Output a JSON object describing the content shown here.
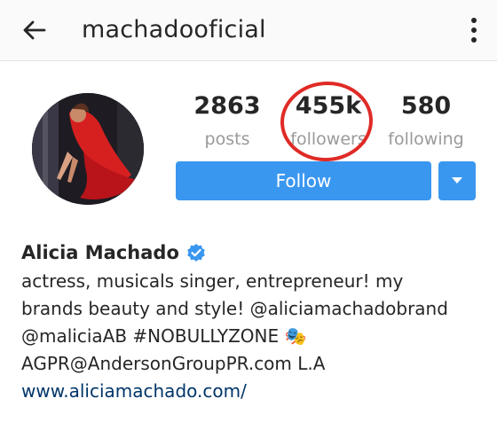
{
  "header": {
    "username": "machadooficial",
    "back_icon": "arrow-back-icon",
    "menu_icon": "more-vertical-icon"
  },
  "profile": {
    "avatar_alt": "profile photo",
    "stats": {
      "posts": {
        "value": "2863",
        "label": "posts"
      },
      "followers": {
        "value": "455k",
        "label": "followers"
      },
      "following": {
        "value": "580",
        "label": "following"
      }
    },
    "follow_label": "Follow",
    "dropdown_icon": "caret-down-icon",
    "name": "Alicia Machado",
    "verified_icon": "verified-badge-icon",
    "bio_lines": [
      "actress, musicals singer, entrepreneur! my",
      "brands beauty and style! @aliciamachadobrand",
      "@maliciaAB #NOBULLYZONE 🎭",
      "AGPR@AndersonGroupPR.com L.A"
    ],
    "website": "www.aliciamachado.com/"
  },
  "colors": {
    "accent_blue": "#3a97f0",
    "link": "#003569",
    "annotation_red": "#e02a25",
    "muted": "#9a9a9a"
  }
}
